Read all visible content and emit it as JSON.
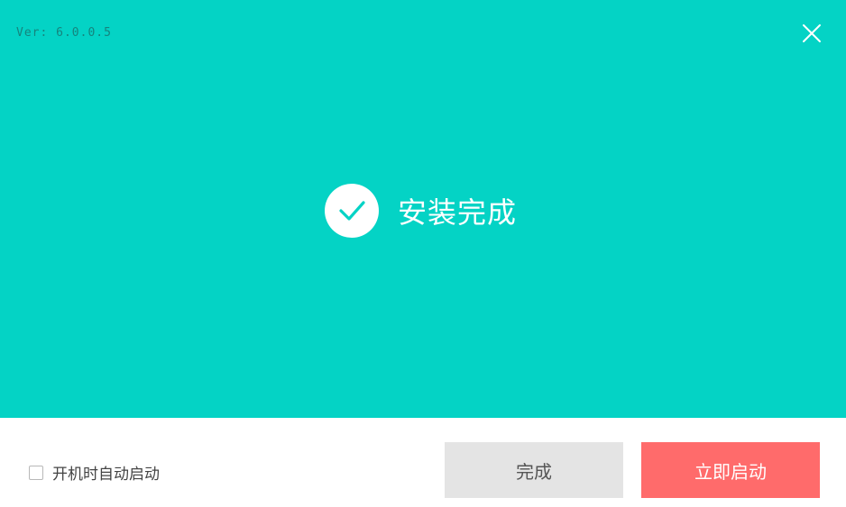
{
  "header": {
    "version": "Ver: 6.0.0.5",
    "close_icon": "close-icon"
  },
  "status": {
    "icon": "check-circle-icon",
    "text": "安装完成"
  },
  "footer": {
    "autostart_label": "开机时自动启动",
    "autostart_checked": false,
    "finish_label": "完成",
    "launch_label": "立即启动"
  },
  "colors": {
    "panel": "#04d3c5",
    "finish_button": "#e4e4e4",
    "launch_button": "#ff6b6b"
  }
}
